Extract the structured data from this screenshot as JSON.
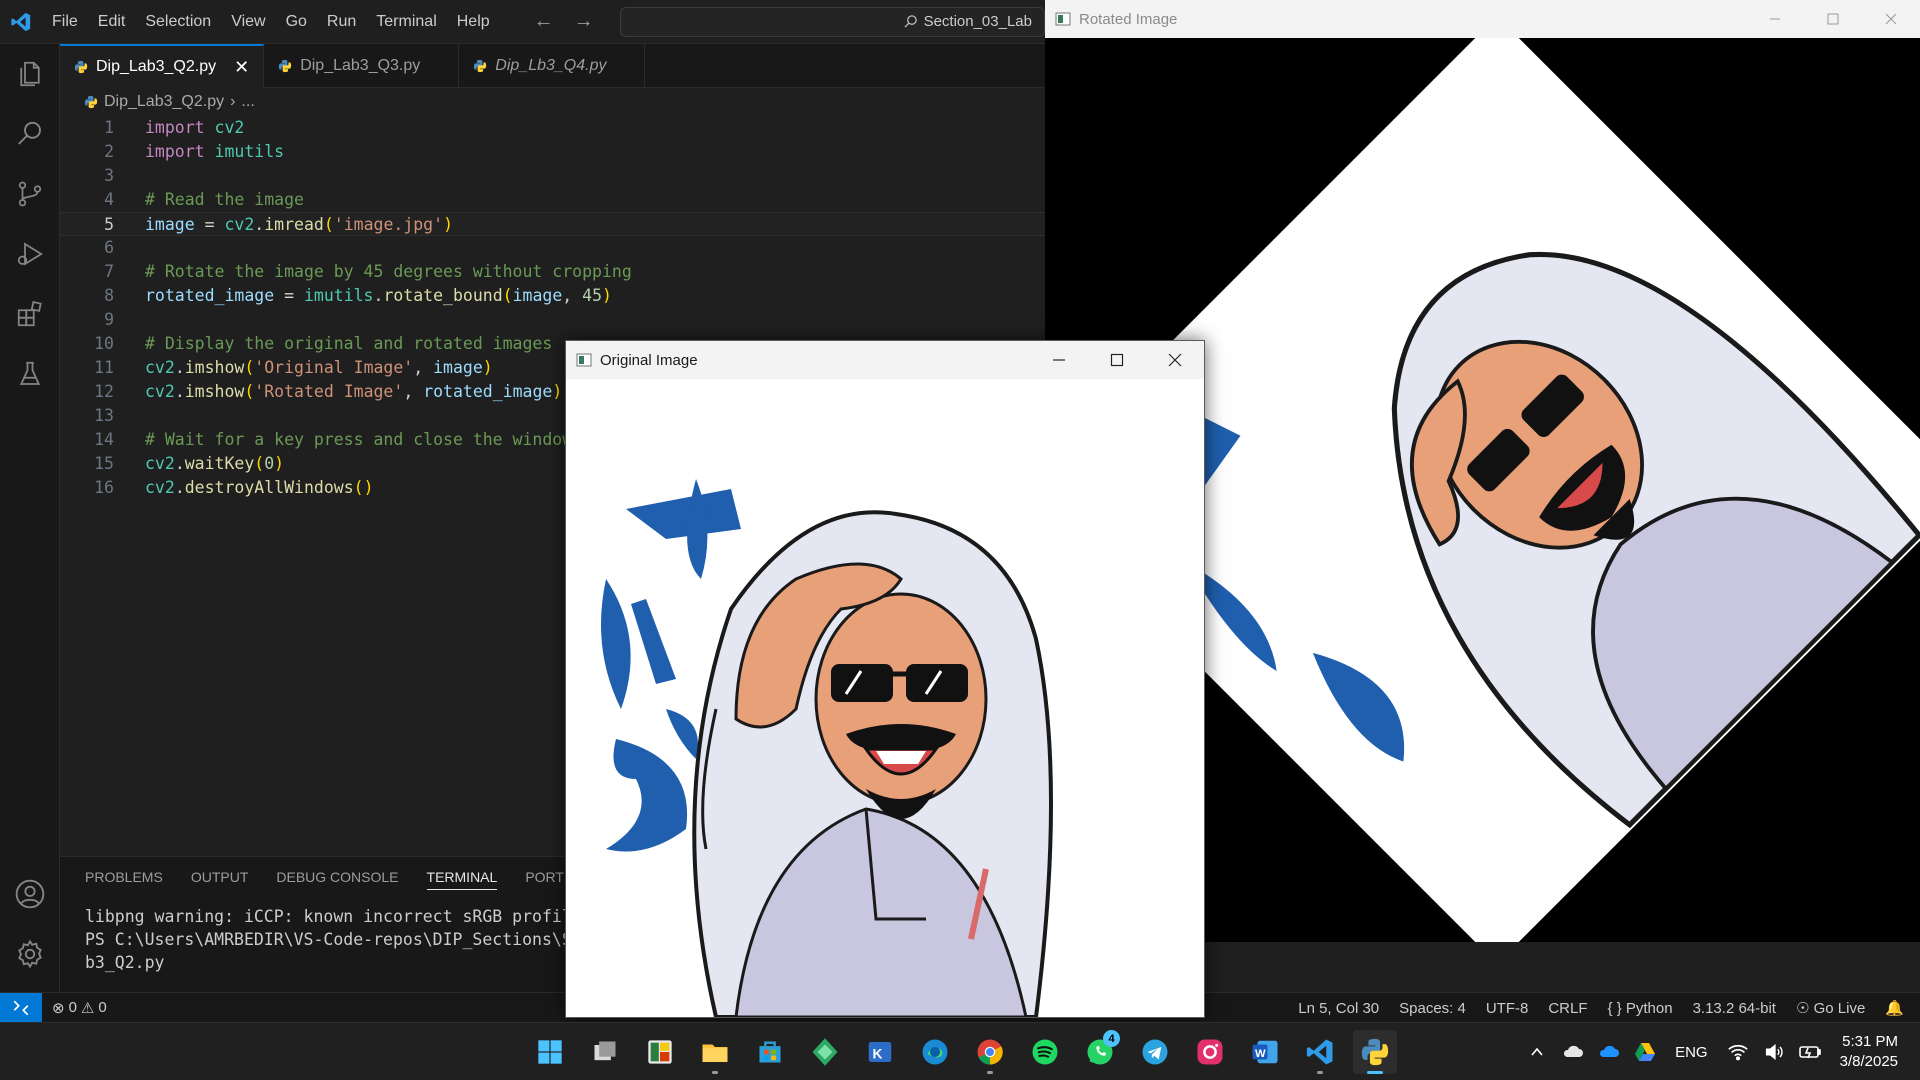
{
  "vscode": {
    "menu": [
      "File",
      "Edit",
      "Selection",
      "View",
      "Go",
      "Run",
      "Terminal",
      "Help"
    ],
    "command_center": "Section_03_Lab",
    "tabs": [
      {
        "label": "Dip_Lab3_Q2.py",
        "active": true
      },
      {
        "label": "Dip_Lab3_Q3.py",
        "active": false
      },
      {
        "label": "Dip_Lb3_Q4.py",
        "active": false
      }
    ],
    "breadcrumb": {
      "file": "Dip_Lab3_Q2.py",
      "rest": "..."
    },
    "line_numbers": [
      "1",
      "2",
      "3",
      "4",
      "5",
      "6",
      "7",
      "8",
      "9",
      "10",
      "11",
      "12",
      "13",
      "14",
      "15",
      "16"
    ],
    "code": {
      "l1_kw": "import",
      "l1_mod": "cv2",
      "l2_kw": "import",
      "l2_mod": "imutils",
      "l4": "# Read the image",
      "l5_var": "image",
      "l5_eq": " = ",
      "l5_mod": "cv2",
      "l5_fn": "imread",
      "l5_str": "'image.jpg'",
      "l7": "# Rotate the image by 45 degrees without cropping",
      "l8_var": "rotated_image",
      "l8_eq": " = ",
      "l8_mod": "imutils",
      "l8_fn": "rotate_bound",
      "l8_arg": "image",
      "l8_num": "45",
      "l10": "# Display the original and rotated images",
      "l11_mod": "cv2",
      "l11_fn": "imshow",
      "l11_str": "'Original Image'",
      "l11_arg": "image",
      "l12_mod": "cv2",
      "l12_fn": "imshow",
      "l12_str": "'Rotated Image'",
      "l12_arg": "rotated_image",
      "l14": "# Wait for a key press and close the windows",
      "l15_mod": "cv2",
      "l15_fn": "waitKey",
      "l15_num": "0",
      "l16_mod": "cv2",
      "l16_fn": "destroyAllWindows"
    },
    "panel_tabs": [
      "PROBLEMS",
      "OUTPUT",
      "DEBUG CONSOLE",
      "TERMINAL",
      "PORTS"
    ],
    "terminal_lines": [
      "libpng warning: iCCP: known incorrect sRGB profile",
      "PS C:\\Users\\AMRBEDIR\\VS-Code-repos\\DIP_Sections\\Secti",
      "b3_Q2.py"
    ],
    "status": {
      "errors": "0",
      "warnings": "0",
      "position": "Ln 5, Col 30",
      "spaces": "Spaces: 4",
      "encoding": "UTF-8",
      "eol": "CRLF",
      "language": "Python",
      "interpreter": "3.13.2 64-bit",
      "live": "Go Live"
    }
  },
  "windows": {
    "rotated_title": "Rotated Image",
    "original_title": "Original Image"
  },
  "taskbar": {
    "apps": [
      "start-icon",
      "task-view-icon",
      "widgets-icon",
      "file-explorer-icon",
      "microsoft-store-icon",
      "app-green-icon",
      "visual-studio-icon",
      "edge-icon",
      "chrome-icon",
      "spotify-icon",
      "whatsapp-icon",
      "telegram-icon",
      "instagram-icon",
      "word-icon",
      "vscode-icon",
      "python-icon"
    ],
    "whatsapp_badge": "4",
    "language": "ENG",
    "time": "5:31 PM",
    "date": "3/8/2025"
  },
  "colors": {
    "accent": "#0078d4",
    "editor_bg": "#1f1f1f",
    "taskbar_bg": "#202020"
  }
}
